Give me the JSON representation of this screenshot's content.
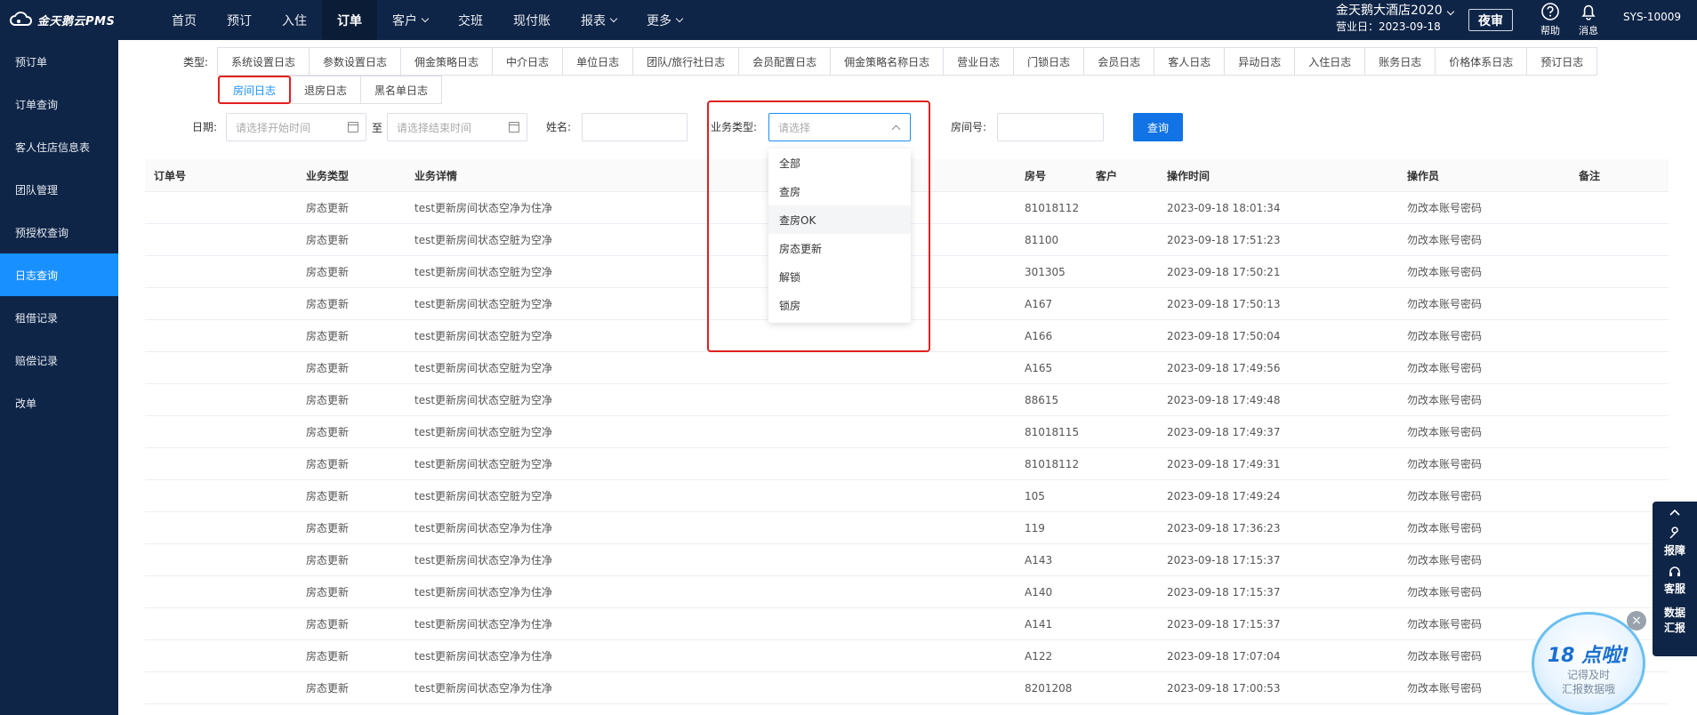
{
  "header": {
    "logo_text": "金天鹅云PMS",
    "nav": [
      {
        "label": "首页",
        "dropdown": false
      },
      {
        "label": "预订",
        "dropdown": false
      },
      {
        "label": "入住",
        "dropdown": false
      },
      {
        "label": "订单",
        "dropdown": false,
        "active": true
      },
      {
        "label": "客户",
        "dropdown": true
      },
      {
        "label": "交班",
        "dropdown": false
      },
      {
        "label": "现付账",
        "dropdown": false
      },
      {
        "label": "报表",
        "dropdown": true
      },
      {
        "label": "更多",
        "dropdown": true
      }
    ],
    "hotel_name": "金天鹅大酒店2020",
    "business_date": "营业日：2023-09-18",
    "night_audit": "夜审",
    "help": "帮助",
    "messages": "消息",
    "user": "SYS-10009"
  },
  "sidebar": {
    "items": [
      "预订单",
      "订单查询",
      "客人住店信息表",
      "团队管理",
      "预授权查询",
      "日志查询",
      "租借记录",
      "赔偿记录",
      "改单"
    ],
    "active_index": 5
  },
  "filters": {
    "type_label": "类型:",
    "types_row1": [
      "系统设置日志",
      "参数设置日志",
      "佣金策略日志",
      "中介日志",
      "单位日志",
      "团队/旅行社日志",
      "会员配置日志",
      "佣金策略名称日志",
      "营业日志",
      "门锁日志",
      "会员日志",
      "客人日志",
      "异动日志",
      "入住日志",
      "账务日志",
      "价格体系日志",
      "预订日志"
    ],
    "types_row2": [
      "房间日志",
      "退房日志",
      "黑名单日志"
    ],
    "active_type": "房间日志",
    "date_label": "日期:",
    "start_placeholder": "请选择开始时间",
    "to": "至",
    "end_placeholder": "请选择结束时间",
    "name_label": "姓名:",
    "biz_type_label": "业务类型:",
    "biz_type_placeholder": "请选择",
    "room_label": "房间号:",
    "query_button": "查询"
  },
  "dropdown": {
    "options": [
      "全部",
      "查房",
      "查房OK",
      "房态更新",
      "解锁",
      "锁房"
    ],
    "hover_index": 2
  },
  "table": {
    "columns": [
      "订单号",
      "业务类型",
      "业务详情",
      "房号",
      "客户",
      "操作时间",
      "操作员",
      "备注"
    ],
    "rows": [
      [
        "",
        "房态更新",
        "test更新房间状态空净为住净",
        "81018112",
        "",
        "2023-09-18 18:01:34",
        "勿改本账号密码",
        ""
      ],
      [
        "",
        "房态更新",
        "test更新房间状态空脏为空净",
        "81100",
        "",
        "2023-09-18 17:51:23",
        "勿改本账号密码",
        ""
      ],
      [
        "",
        "房态更新",
        "test更新房间状态空脏为空净",
        "301305",
        "",
        "2023-09-18 17:50:21",
        "勿改本账号密码",
        ""
      ],
      [
        "",
        "房态更新",
        "test更新房间状态空脏为空净",
        "A167",
        "",
        "2023-09-18 17:50:13",
        "勿改本账号密码",
        ""
      ],
      [
        "",
        "房态更新",
        "test更新房间状态空脏为空净",
        "A166",
        "",
        "2023-09-18 17:50:04",
        "勿改本账号密码",
        ""
      ],
      [
        "",
        "房态更新",
        "test更新房间状态空脏为空净",
        "A165",
        "",
        "2023-09-18 17:49:56",
        "勿改本账号密码",
        ""
      ],
      [
        "",
        "房态更新",
        "test更新房间状态空脏为空净",
        "88615",
        "",
        "2023-09-18 17:49:48",
        "勿改本账号密码",
        ""
      ],
      [
        "",
        "房态更新",
        "test更新房间状态空脏为空净",
        "81018115",
        "",
        "2023-09-18 17:49:37",
        "勿改本账号密码",
        ""
      ],
      [
        "",
        "房态更新",
        "test更新房间状态空脏为空净",
        "81018112",
        "",
        "2023-09-18 17:49:31",
        "勿改本账号密码",
        ""
      ],
      [
        "",
        "房态更新",
        "test更新房间状态空脏为空净",
        "105",
        "",
        "2023-09-18 17:49:24",
        "勿改本账号密码",
        ""
      ],
      [
        "",
        "房态更新",
        "test更新房间状态空净为住净",
        "119",
        "",
        "2023-09-18 17:36:23",
        "勿改本账号密码",
        ""
      ],
      [
        "",
        "房态更新",
        "test更新房间状态空净为住净",
        "A143",
        "",
        "2023-09-18 17:15:37",
        "勿改本账号密码",
        ""
      ],
      [
        "",
        "房态更新",
        "test更新房间状态空净为住净",
        "A140",
        "",
        "2023-09-18 17:15:37",
        "勿改本账号密码",
        ""
      ],
      [
        "",
        "房态更新",
        "test更新房间状态空净为住净",
        "A141",
        "",
        "2023-09-18 17:15:37",
        "勿改本账号密码",
        ""
      ],
      [
        "",
        "房态更新",
        "test更新房间状态空净为住净",
        "A122",
        "",
        "2023-09-18 17:07:04",
        "勿改本账号密码",
        ""
      ],
      [
        "",
        "房态更新",
        "test更新房间状态空净为住净",
        "8201208",
        "",
        "2023-09-18 17:00:53",
        "勿改本账号密码",
        ""
      ]
    ]
  },
  "float_panel": {
    "items": [
      "报障",
      "客服",
      "数据汇报"
    ]
  },
  "promo": {
    "title": "18 点啦!",
    "line1": "记得及时",
    "line2": "汇报数据哦"
  },
  "colors": {
    "nav_bg": "#0f2547",
    "accent": "#1890ff",
    "highlight": "#e02020"
  }
}
